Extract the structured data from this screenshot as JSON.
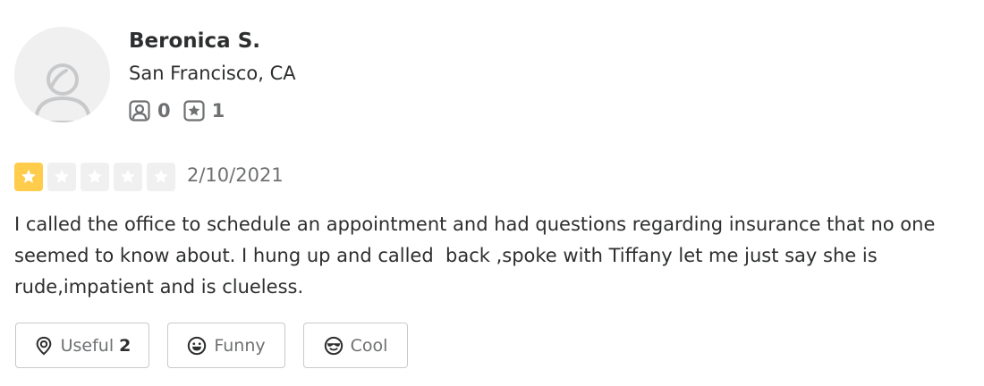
{
  "user": {
    "name": "Beronica S.",
    "location": "San Francisco, CA",
    "friends_count": "0",
    "reviews_count": "1",
    "avatar_icon": "default-user-avatar"
  },
  "review": {
    "rating": 1,
    "rating_max": 5,
    "date": "2/10/2021",
    "text": "I called the office to schedule an appointment and had questions regarding insurance that no one seemed to know about. I hung up and called  back ,spoke with Tiffany let me just say she is rude,impatient and is clueless."
  },
  "reactions": {
    "useful_label": "Useful",
    "useful_count": "2",
    "funny_label": "Funny",
    "cool_label": "Cool"
  },
  "colors": {
    "star_filled": "#ffcc4b",
    "star_empty": "#f0f0f0",
    "text_primary": "#2d2e2f",
    "text_secondary": "#6e7072",
    "border": "#c8c9ca"
  }
}
